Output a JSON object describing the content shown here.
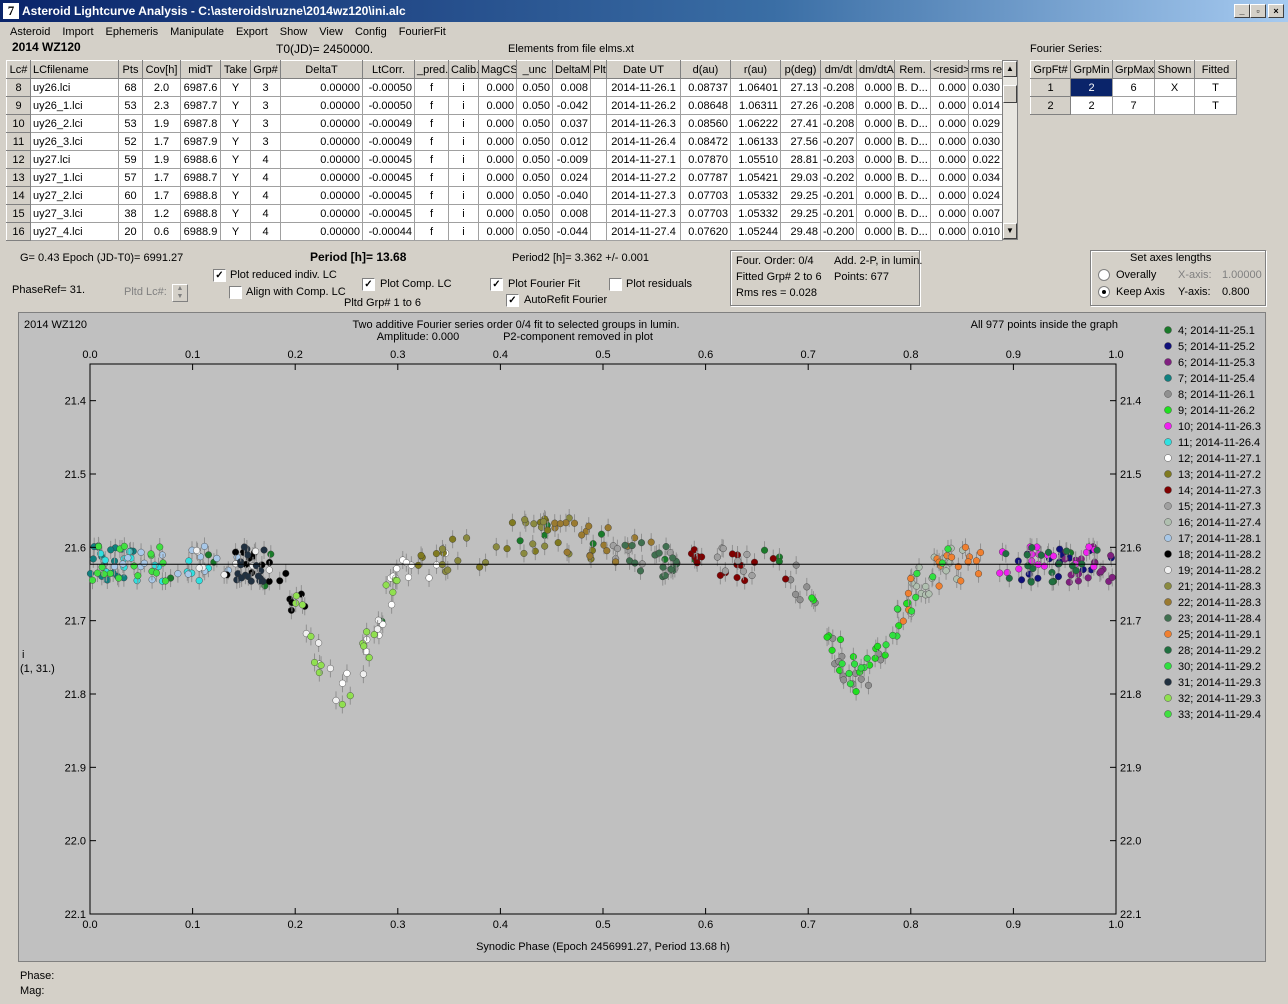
{
  "window": {
    "title": "Asteroid Lightcurve Analysis - C:\\asteroids\\ruzne\\2014wz120\\ini.alc",
    "icon_glyph": "7",
    "buttons": [
      "_",
      "▫",
      "×"
    ]
  },
  "menu": [
    "Asteroid",
    "Import",
    "Ephemeris",
    "Manipulate",
    "Export",
    "Show",
    "View",
    "Config",
    "FourierFit"
  ],
  "header": {
    "object": "2014 WZ120",
    "t0": "T0(JD)= 2450000.",
    "elements": "Elements from file elms.xt",
    "fourier_title": "Fourier Series:"
  },
  "lc_table": {
    "columns": [
      "Lc#",
      "LCfilename",
      "Pts",
      "Cov[h]",
      "midT",
      "Take",
      "Grp#",
      "DeltaT",
      "LtCorr.",
      "_pred.",
      "Calib.",
      "MagCS",
      "_unc",
      "DeltaM",
      "Plt",
      "Date UT",
      "d(au)",
      "r(au)",
      "p(deg)",
      "dm/dt",
      "dm/dtA",
      "Rem.",
      "<resid>",
      "rms res"
    ],
    "rows": [
      [
        "8",
        "uy26.lci",
        "68",
        "2.0",
        "6987.6",
        "Y",
        "3",
        "0.00000",
        "-0.00050",
        "f",
        "i",
        "0.000",
        "0.050",
        "0.008",
        "",
        "2014-11-26.1",
        "0.08737",
        "1.06401",
        "27.13",
        "-0.208",
        "0.000",
        "B. D...",
        "0.000",
        "0.030"
      ],
      [
        "9",
        "uy26_1.lci",
        "53",
        "2.3",
        "6987.7",
        "Y",
        "3",
        "0.00000",
        "-0.00050",
        "f",
        "i",
        "0.000",
        "0.050",
        "-0.042",
        "",
        "2014-11-26.2",
        "0.08648",
        "1.06311",
        "27.26",
        "-0.208",
        "0.000",
        "B. D...",
        "0.000",
        "0.014"
      ],
      [
        "10",
        "uy26_2.lci",
        "53",
        "1.9",
        "6987.8",
        "Y",
        "3",
        "0.00000",
        "-0.00049",
        "f",
        "i",
        "0.000",
        "0.050",
        "0.037",
        "",
        "2014-11-26.3",
        "0.08560",
        "1.06222",
        "27.41",
        "-0.208",
        "0.000",
        "B. D...",
        "0.000",
        "0.029"
      ],
      [
        "11",
        "uy26_3.lci",
        "52",
        "1.7",
        "6987.9",
        "Y",
        "3",
        "0.00000",
        "-0.00049",
        "f",
        "i",
        "0.000",
        "0.050",
        "0.012",
        "",
        "2014-11-26.4",
        "0.08472",
        "1.06133",
        "27.56",
        "-0.207",
        "0.000",
        "B. D...",
        "0.000",
        "0.030"
      ],
      [
        "12",
        "uy27.lci",
        "59",
        "1.9",
        "6988.6",
        "Y",
        "4",
        "0.00000",
        "-0.00045",
        "f",
        "i",
        "0.000",
        "0.050",
        "-0.009",
        "",
        "2014-11-27.1",
        "0.07870",
        "1.05510",
        "28.81",
        "-0.203",
        "0.000",
        "B. D...",
        "0.000",
        "0.022"
      ],
      [
        "13",
        "uy27_1.lci",
        "57",
        "1.7",
        "6988.7",
        "Y",
        "4",
        "0.00000",
        "-0.00045",
        "f",
        "i",
        "0.000",
        "0.050",
        "0.024",
        "",
        "2014-11-27.2",
        "0.07787",
        "1.05421",
        "29.03",
        "-0.202",
        "0.000",
        "B. D...",
        "0.000",
        "0.034"
      ],
      [
        "14",
        "uy27_2.lci",
        "60",
        "1.7",
        "6988.8",
        "Y",
        "4",
        "0.00000",
        "-0.00045",
        "f",
        "i",
        "0.000",
        "0.050",
        "-0.040",
        "",
        "2014-11-27.3",
        "0.07703",
        "1.05332",
        "29.25",
        "-0.201",
        "0.000",
        "B. D...",
        "0.000",
        "0.024"
      ],
      [
        "15",
        "uy27_3.lci",
        "38",
        "1.2",
        "6988.8",
        "Y",
        "4",
        "0.00000",
        "-0.00045",
        "f",
        "i",
        "0.000",
        "0.050",
        "0.008",
        "",
        "2014-11-27.3",
        "0.07703",
        "1.05332",
        "29.25",
        "-0.201",
        "0.000",
        "B. D...",
        "0.000",
        "0.007"
      ],
      [
        "16",
        "uy27_4.lci",
        "20",
        "0.6",
        "6988.9",
        "Y",
        "4",
        "0.00000",
        "-0.00044",
        "f",
        "i",
        "0.000",
        "0.050",
        "-0.044",
        "",
        "2014-11-27.4",
        "0.07620",
        "1.05244",
        "29.48",
        "-0.200",
        "0.000",
        "B. D...",
        "0.000",
        "0.010"
      ]
    ]
  },
  "fourier_table": {
    "columns": [
      "GrpFt#",
      "GrpMin",
      "GrpMax",
      "Shown",
      "Fitted"
    ],
    "rows": [
      [
        "1",
        "2",
        "6",
        "X",
        "T"
      ],
      [
        "2",
        "2",
        "7",
        "",
        "T"
      ]
    ]
  },
  "controls": {
    "g_epoch": "G= 0.43   Epoch (JD-T0)= 6991.27",
    "period": "Period [h]= 13.68",
    "period2": "Period2 [h]= 3.362 +/- 0.001",
    "phaseref": "PhaseRef= 31.",
    "pltd_lc": "Pltd Lc#:",
    "plot_reduced": "Plot reduced indiv. LC",
    "align_comp": "Align with Comp. LC",
    "plot_comp": "Plot Comp. LC",
    "pltd_grp": "Pltd Grp#  1   to   6",
    "plot_fourier": "Plot Fourier Fit",
    "autorefit": "AutoRefit Fourier",
    "plot_residuals": "Plot residuals",
    "check_glyph": "✓",
    "info": {
      "four_order": "Four. Order:  0/4",
      "add": "Add. 2-P, in lumin.",
      "fitted": "Fitted Grp# 2 to 6",
      "points": "Points: 677",
      "rms": "Rms res     = 0.028"
    },
    "axes": {
      "title": "Set axes lengths",
      "overally": "Overally",
      "keep": "Keep Axis",
      "xaxis": "X-axis:",
      "xval": "1.00000",
      "yaxis": "Y-axis:",
      "yval": "0.800"
    }
  },
  "plot": {
    "name": "2014 WZ120",
    "subtitle1": "Two additive Fourier series order 0/4 fit to selected groups in lumin.",
    "subtitle2": "Amplitude: 0.000",
    "subtitle3": "P2-component removed in plot",
    "points_note": "All 977 points inside the graph",
    "y_label_top": "i",
    "y_label_bottom": "(1, 31.)",
    "x_label": "Synodic Phase (Epoch 2456991.27, Period 13.68 h)"
  },
  "chart_data": {
    "type": "scatter",
    "xlim": [
      0.0,
      1.0
    ],
    "ylim": [
      22.1,
      21.35
    ],
    "x_ticks": [
      "0.0",
      "0.1",
      "0.2",
      "0.3",
      "0.4",
      "0.5",
      "0.6",
      "0.7",
      "0.8",
      "0.9",
      "1.0"
    ],
    "y_ticks": [
      "21.4",
      "21.5",
      "21.6",
      "21.7",
      "21.8",
      "21.9",
      "22.0",
      "22.1"
    ],
    "fit_line_mag": 21.623,
    "legend_position": "right",
    "series": [
      {
        "name": "4; 2014-11-25.1",
        "color": "#1a7a2a",
        "x0": 0.0,
        "x1": 1.0
      },
      {
        "name": "5; 2014-11-25.2",
        "color": "#10107a",
        "x0": 0.9,
        "x1": 1.0
      },
      {
        "name": "6; 2014-11-25.3",
        "color": "#802080",
        "x0": 0.95,
        "x1": 1.0
      },
      {
        "name": "7; 2014-11-25.4",
        "color": "#108080",
        "x0": 0.0,
        "x1": 0.05
      },
      {
        "name": "8; 2014-11-26.1",
        "color": "#909090",
        "x0": 0.68,
        "x1": 0.78
      },
      {
        "name": "9; 2014-11-26.2",
        "color": "#20e020",
        "x0": 0.7,
        "x1": 0.8
      },
      {
        "name": "10; 2014-11-26.3",
        "color": "#f020f0",
        "x0": 0.88,
        "x1": 0.99
      },
      {
        "name": "11; 2014-11-26.4",
        "color": "#30e0e0",
        "x0": 0.0,
        "x1": 0.12
      },
      {
        "name": "12; 2014-11-27.1",
        "color": "#ffffff",
        "x0": 0.24,
        "x1": 0.36
      },
      {
        "name": "13; 2014-11-27.2",
        "color": "#807a20",
        "x0": 0.32,
        "x1": 0.52
      },
      {
        "name": "14; 2014-11-27.3",
        "color": "#800000",
        "x0": 0.58,
        "x1": 0.69
      },
      {
        "name": "15; 2014-11-27.3",
        "color": "#a0a0a0",
        "x0": 0.51,
        "x1": 0.65
      },
      {
        "name": "16; 2014-11-27.4",
        "color": "#b0c0b0",
        "x0": 0.8,
        "x1": 0.86
      },
      {
        "name": "17; 2014-11-28.1",
        "color": "#a8c8e8",
        "x0": 0.02,
        "x1": 0.15
      },
      {
        "name": "18; 2014-11-28.2",
        "color": "#000000",
        "x0": 0.13,
        "x1": 0.21
      },
      {
        "name": "19; 2014-11-28.2",
        "color": "#f0f0f0",
        "x0": 0.09,
        "x1": 0.3
      },
      {
        "name": "21; 2014-11-28.3",
        "color": "#8a8a40",
        "x0": 0.33,
        "x1": 0.47
      },
      {
        "name": "22; 2014-11-28.3",
        "color": "#9a7a30",
        "x0": 0.44,
        "x1": 0.55
      },
      {
        "name": "23; 2014-11-28.4",
        "color": "#407050",
        "x0": 0.52,
        "x1": 0.58
      },
      {
        "name": "25; 2014-11-29.1",
        "color": "#f08030",
        "x0": 0.79,
        "x1": 0.87
      },
      {
        "name": "28; 2014-11-29.2",
        "color": "#207040",
        "x0": 0.89,
        "x1": 0.99
      },
      {
        "name": "30; 2014-11-29.2",
        "color": "#30e040",
        "x0": 0.73,
        "x1": 0.84
      },
      {
        "name": "31; 2014-11-29.3",
        "color": "#203040",
        "x0": 0.14,
        "x1": 0.17
      },
      {
        "name": "32; 2014-11-29.3",
        "color": "#90e050",
        "x0": 0.2,
        "x1": 0.3
      },
      {
        "name": "33; 2014-11-29.4",
        "color": "#40e040",
        "x0": 0.0,
        "x1": 0.08
      }
    ]
  },
  "status": {
    "phase": "Phase:",
    "mag": "Mag:"
  }
}
